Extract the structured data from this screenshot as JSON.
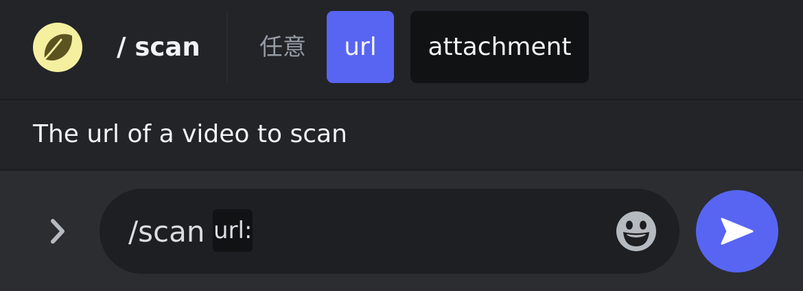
{
  "header": {
    "avatar_icon": "leaf-icon",
    "command_name": "/ scan",
    "optional_label": "任意",
    "options": [
      {
        "label": "url",
        "selected": true
      },
      {
        "label": "attachment",
        "selected": false
      }
    ]
  },
  "description": {
    "text": "The url of a video to scan"
  },
  "input": {
    "command_text": "/scan",
    "option_token": "url:",
    "expand_icon": "chevron-right-icon",
    "emoji_icon": "emoji-icon",
    "send_icon": "send-icon"
  },
  "colors": {
    "accent": "#5865f2",
    "avatar_bg": "#f5f0a0",
    "leaf": "#5c5420",
    "header_bg": "#232428",
    "input_bg": "#2b2d31",
    "field_bg": "#1e1f22",
    "chip_dark": "#111214",
    "muted_text": "#949ba4"
  }
}
